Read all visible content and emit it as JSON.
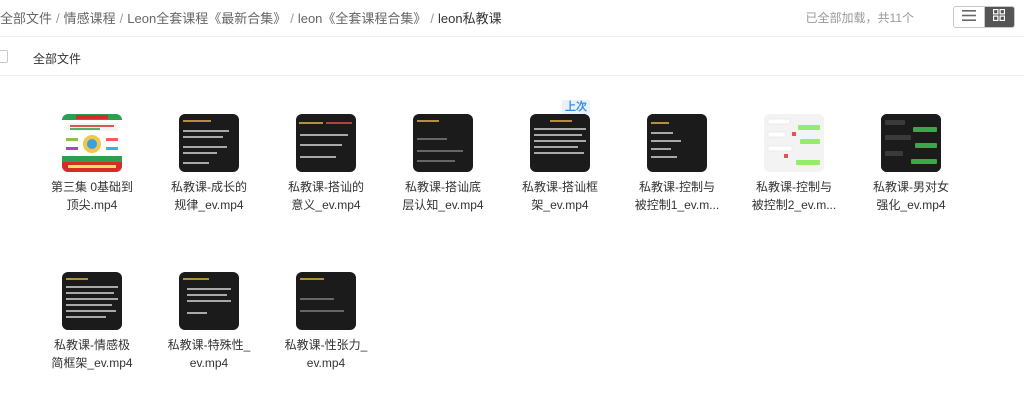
{
  "breadcrumb": {
    "items": [
      "全部文件",
      "情感课程",
      "Leon全套课程《最新合集》",
      "leon《全套课程合集》"
    ],
    "separator": "/",
    "current": "leon私教课"
  },
  "status_text": "已全部加载，共11个",
  "view_toggle": {
    "list_icon": "list-view-icon",
    "grid_icon": "grid-view-icon",
    "active": "grid"
  },
  "header": {
    "column_label": "全部文件"
  },
  "files": [
    {
      "name_line1": "第三集 0基础到",
      "name_line2": "顶尖.mp4",
      "thumb_style": "poster",
      "badge": ""
    },
    {
      "name_line1": "私教课-成长的",
      "name_line2": "规律_ev.mp4",
      "thumb_style": "dark",
      "badge": ""
    },
    {
      "name_line1": "私教课-搭讪的",
      "name_line2": "意义_ev.mp4",
      "thumb_style": "dark",
      "badge": ""
    },
    {
      "name_line1": "私教课-搭讪底",
      "name_line2": "层认知_ev.mp4",
      "thumb_style": "dark",
      "badge": ""
    },
    {
      "name_line1": "私教课-搭讪框",
      "name_line2": "架_ev.mp4",
      "thumb_style": "dark",
      "badge": "上次"
    },
    {
      "name_line1": "私教课-控制与",
      "name_line2": "被控制1_ev.m...",
      "thumb_style": "dark",
      "badge": ""
    },
    {
      "name_line1": "私教课-控制与",
      "name_line2": "被控制2_ev.m...",
      "thumb_style": "chat-light",
      "badge": ""
    },
    {
      "name_line1": "私教课-男对女",
      "name_line2": "强化_ev.mp4",
      "thumb_style": "chat-dark",
      "badge": ""
    },
    {
      "name_line1": "私教课-情感极",
      "name_line2": "简框架_ev.mp4",
      "thumb_style": "dark",
      "badge": ""
    },
    {
      "name_line1": "私教课-特殊性_",
      "name_line2": "ev.mp4",
      "thumb_style": "dark",
      "badge": ""
    },
    {
      "name_line1": "私教课-性张力_",
      "name_line2": "ev.mp4",
      "thumb_style": "dark",
      "badge": ""
    }
  ],
  "colors": {
    "accent": "#3a8ee6",
    "poster_green": "#2e9e4f",
    "poster_red": "#d62b2b",
    "thumb_dark": "#1b1b1b"
  }
}
